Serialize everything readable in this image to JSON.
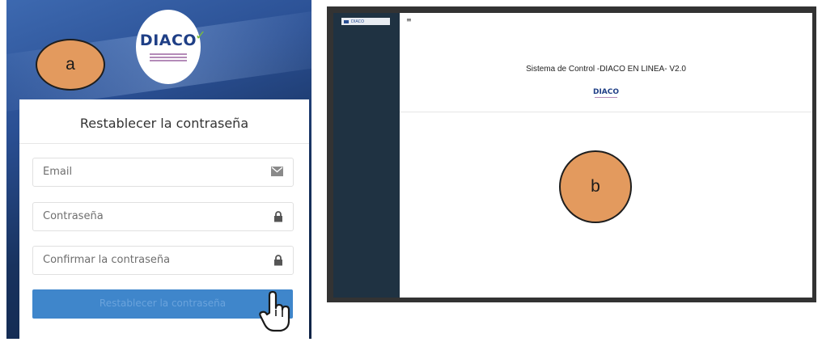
{
  "panel_a": {
    "callout_label": "a",
    "logo_text": "DIACO",
    "form_title": "Restablecer la contraseña",
    "fields": [
      {
        "placeholder": "Email",
        "icon": "envelope-icon"
      },
      {
        "placeholder": "Contraseña",
        "icon": "lock-icon"
      },
      {
        "placeholder": "Confirmar la contraseña",
        "icon": "lock-icon"
      }
    ],
    "submit_label": "Restablecer la contraseña",
    "colors": {
      "button": "#3f86cb",
      "header_bg": "#2a4f93",
      "callout": "#e39a5e"
    }
  },
  "panel_b": {
    "callout_label": "b",
    "sidebar_brand": "DIACO",
    "toggle": "≡",
    "system_title": "Sistema de Control -DIACO EN LINEA- V2.0",
    "logo_text": "DIACO",
    "colors": {
      "sidebar": "#1f3242"
    }
  }
}
